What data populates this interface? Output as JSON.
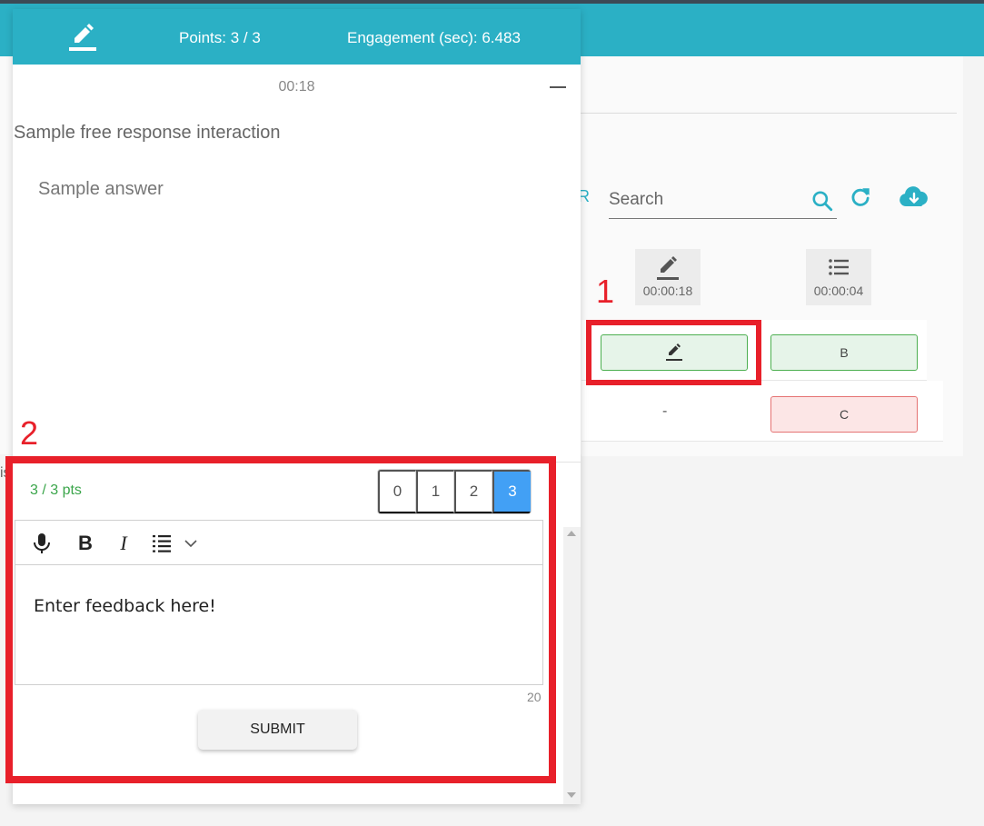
{
  "header": {
    "pen_icon": "pencil-underline-icon",
    "points": "Points: 3 / 3",
    "engagement": "Engagement (sec): 6.483"
  },
  "timer": "00:18",
  "question": "Sample free response interaction",
  "answer": "Sample answer",
  "grading": {
    "pts_label": "3 / 3 pts",
    "scores": [
      "0",
      "1",
      "2",
      "3"
    ],
    "selected_score": "3"
  },
  "editor": {
    "placeholder": "Enter feedback here!",
    "char_count": "20",
    "toolbar": [
      "microphone-icon",
      "bold-icon",
      "italic-icon",
      "list-icon",
      "chevron-down-icon"
    ],
    "bold_label": "B",
    "italic_label": "I"
  },
  "submit_label": "SUBMIT",
  "background": {
    "truncated_left": "R",
    "truncated_is": "is",
    "search_placeholder": "Search",
    "columns": [
      {
        "icon": "pencil-underline-icon",
        "time": "00:00:18"
      },
      {
        "icon": "list-icon",
        "time": "00:00:04"
      }
    ],
    "rows": [
      {
        "col1": "edit",
        "col2": "B"
      },
      {
        "col1": "-",
        "col2": "C"
      }
    ]
  },
  "annotations": [
    "1",
    "2"
  ],
  "colors": {
    "teal": "#2bb0c5",
    "selected_blue": "#42a0f5",
    "annotation_red": "#e8202a",
    "success_green": "#3aa54a"
  }
}
